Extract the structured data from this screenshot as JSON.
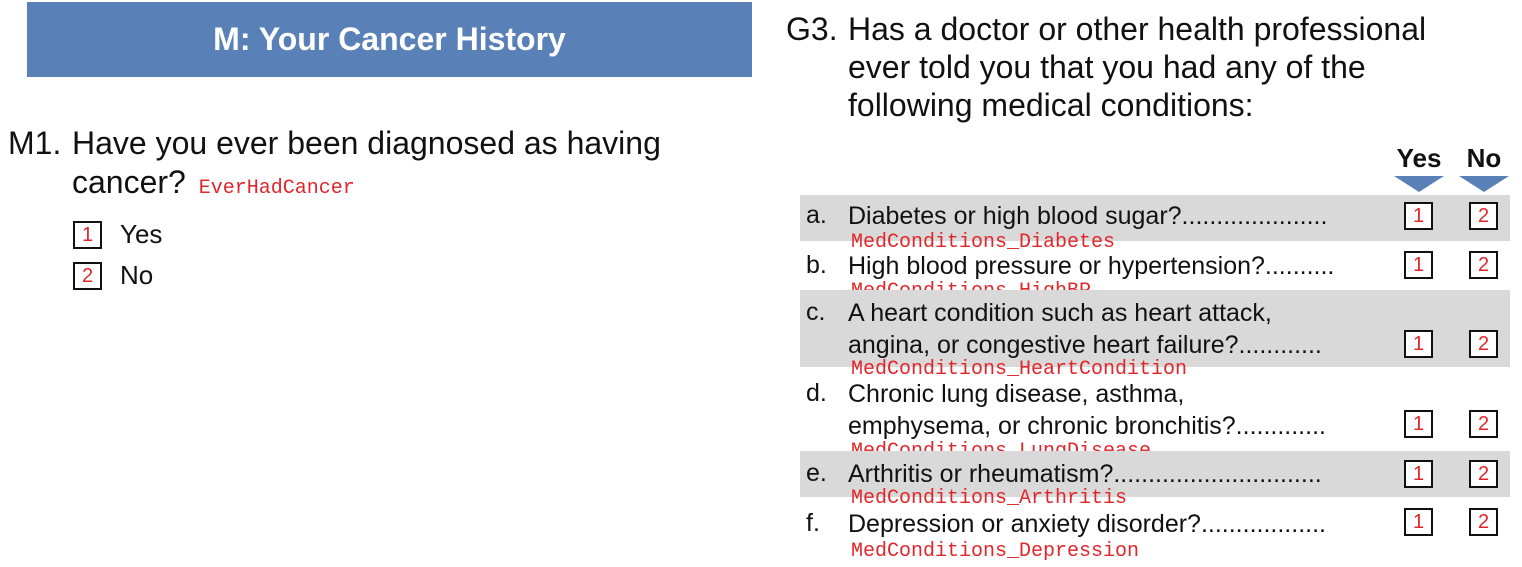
{
  "left": {
    "section_title": "M: Your Cancer History",
    "question": {
      "number": "M1.",
      "line1": "Have you ever been diagnosed as having",
      "line2": "cancer?",
      "variable": "EverHadCancer",
      "options": [
        {
          "code": "1",
          "label": "Yes"
        },
        {
          "code": "2",
          "label": "No"
        }
      ]
    }
  },
  "right": {
    "question": {
      "number": "G3.",
      "lines": [
        "Has a doctor or other health professional",
        "ever told you that you had any of the",
        "following medical conditions:"
      ]
    },
    "columns": {
      "yes": "Yes",
      "no": "No"
    },
    "codes": {
      "yes": "1",
      "no": "2"
    },
    "accent_color": "#5a81b7",
    "shade_color": "#d9d9d9",
    "variable_color": "#e0262b",
    "items": [
      {
        "letter": "a.",
        "lines": [
          "Diabetes or high blood sugar?....................."
        ],
        "variable": "MedConditions_Diabetes"
      },
      {
        "letter": "b.",
        "lines": [
          "High blood pressure or hypertension?.........."
        ],
        "variable": "MedConditions_HighBP"
      },
      {
        "letter": "c.",
        "lines": [
          "A heart condition such as heart attack,",
          "angina, or congestive heart failure?............"
        ],
        "variable": "MedConditions_HeartCondition"
      },
      {
        "letter": "d.",
        "lines": [
          "Chronic lung disease, asthma,",
          "emphysema, or chronic bronchitis?............."
        ],
        "variable": "MedConditions_LungDisease"
      },
      {
        "letter": "e.",
        "lines": [
          "Arthritis or rheumatism?.............................."
        ],
        "variable": "MedConditions_Arthritis"
      },
      {
        "letter": "f.",
        "lines": [
          "Depression or anxiety disorder?.................."
        ],
        "variable": "MedConditions_Depression"
      }
    ]
  }
}
